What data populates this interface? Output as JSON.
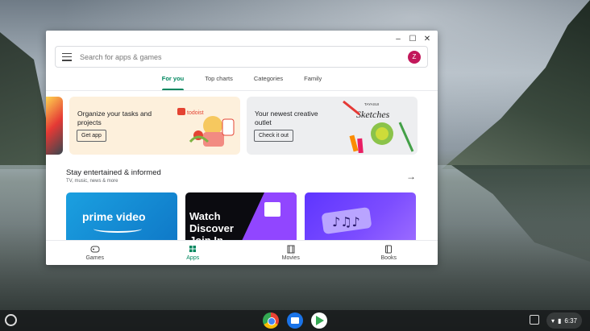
{
  "window": {
    "controls": {
      "minimize": "–",
      "maximize": "☐",
      "close": "✕"
    },
    "search": {
      "placeholder": "Search for apps & games"
    },
    "avatar_letter": "Z",
    "tabs": [
      {
        "label": "For you",
        "active": true
      },
      {
        "label": "Top charts",
        "active": false
      },
      {
        "label": "Categories",
        "active": false
      },
      {
        "label": "Family",
        "active": false
      }
    ],
    "promos": [
      {
        "text": "Organize your tasks and projects",
        "button": "Get app",
        "brand": "todoist"
      },
      {
        "text": "Your newest creative outlet",
        "button": "Check it out",
        "brand": "TAYASUI",
        "art_title": "Sketches"
      }
    ],
    "section": {
      "title": "Stay entertained & informed",
      "subtitle": "TV, music, news & more"
    },
    "cards": [
      {
        "name": "prime-video",
        "label": "prime video"
      },
      {
        "name": "twitch",
        "label": "Watch Discover Join In"
      },
      {
        "name": "music-app",
        "label": ""
      }
    ],
    "bottom_nav": [
      {
        "label": "Games",
        "active": false
      },
      {
        "label": "Apps",
        "active": true
      },
      {
        "label": "Movies",
        "active": false
      },
      {
        "label": "Books",
        "active": false
      }
    ],
    "accent_color": "#01875f"
  },
  "shelf": {
    "apps": [
      "chrome",
      "files",
      "play-store"
    ],
    "time": "6:37"
  }
}
